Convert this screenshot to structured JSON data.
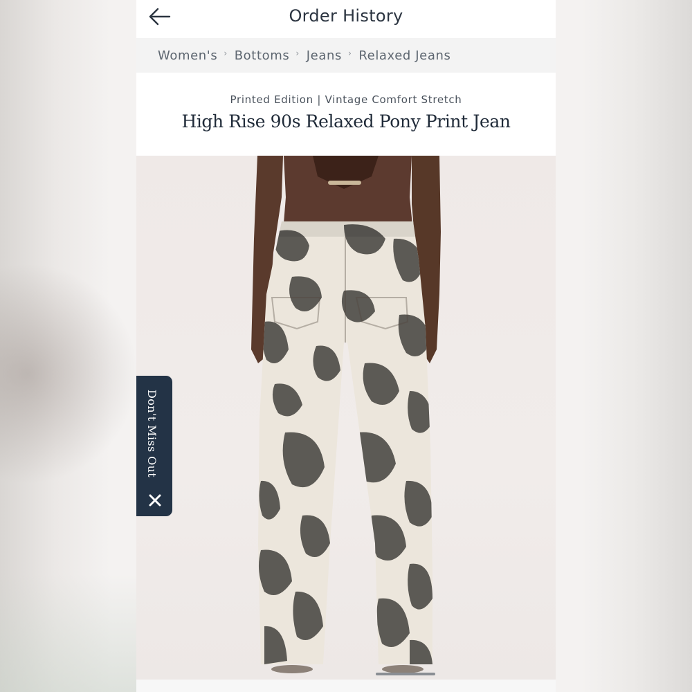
{
  "header": {
    "title": "Order History",
    "back_icon": "arrow-left-icon"
  },
  "breadcrumb": {
    "items": [
      "Women's",
      "Bottoms",
      "Jeans",
      "Relaxed Jeans"
    ],
    "separator": "›"
  },
  "product": {
    "subtitle": "Printed Edition | Vintage Comfort Stretch",
    "name": "High Rise 90s Relaxed Pony Print Jean"
  },
  "promo": {
    "label": "Don't Miss Out",
    "close_icon": "close-icon"
  },
  "colors": {
    "accent_navy": "#233346",
    "text_dark": "#1f2a38",
    "breadcrumb_bg": "#f3f3f3"
  }
}
